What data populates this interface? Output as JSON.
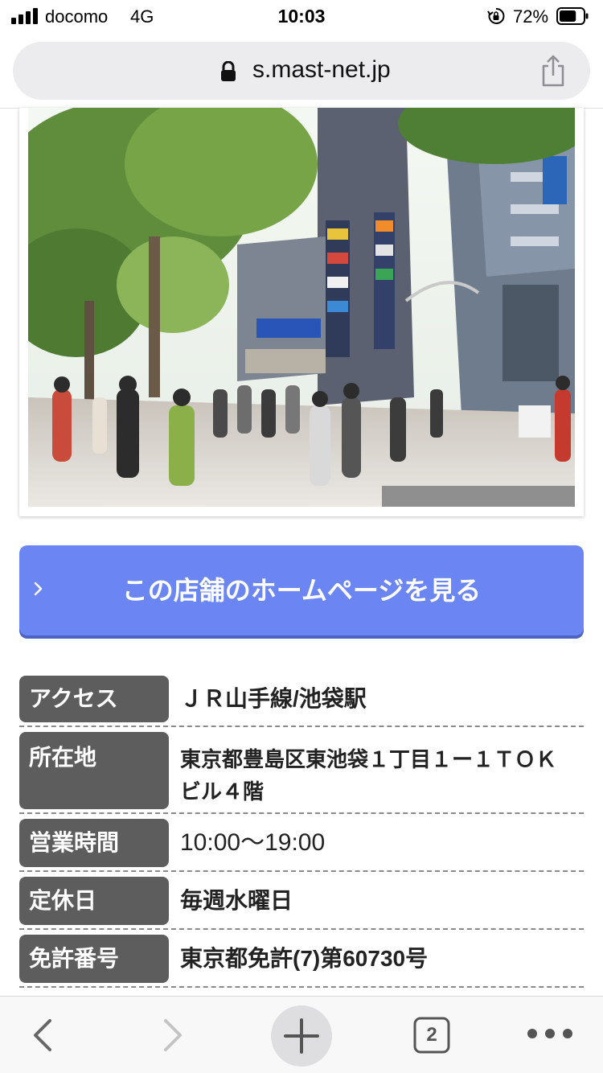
{
  "status_bar": {
    "carrier": "docomo",
    "network": "4G",
    "time": "10:03",
    "battery_percent": "72%",
    "battery_level": 0.72
  },
  "address_bar": {
    "url": "s.mast-net.jp",
    "lock_icon": "lock-icon",
    "share_icon": "share-icon"
  },
  "photo": {
    "icon": "storefront-street-photo"
  },
  "cta": {
    "label": "この店舗のホームページを見る",
    "icon": "chevron-right-icon",
    "color": "#6b86f2"
  },
  "info": {
    "rows": [
      {
        "label": "アクセス",
        "value": "ＪＲ山手線/池袋駅"
      },
      {
        "label": "所在地",
        "value": "東京都豊島区東池袋１丁目１ー１ＴＯＫビル４階"
      },
      {
        "label": "営業時間",
        "value": "10:00〜19:00"
      },
      {
        "label": "定休日",
        "value": "毎週水曜日"
      },
      {
        "label": "免許番号",
        "value": "東京都免許(7)第60730号"
      }
    ],
    "label_color": "#5d5d5d"
  },
  "toolbar": {
    "back_icon": "chevron-left-icon",
    "forward_icon": "chevron-right-icon",
    "new_tab_icon": "plus-icon",
    "tabs_count": "2",
    "more_icon": "more-dots-icon"
  }
}
